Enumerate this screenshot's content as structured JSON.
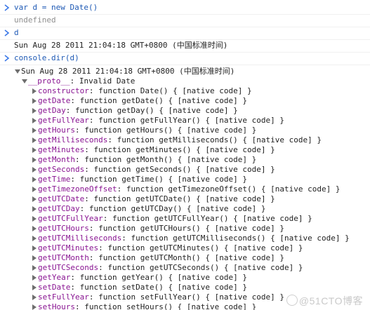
{
  "console": {
    "entries": [
      {
        "kind": "input",
        "text": "var d = new Date()"
      },
      {
        "kind": "result",
        "text": "undefined"
      },
      {
        "kind": "input",
        "text": "d"
      },
      {
        "kind": "result",
        "text": "Sun Aug 28 2011 21:04:18 GMT+0800 (中国标准时间)"
      },
      {
        "kind": "input",
        "text": "console.dir(d)"
      }
    ],
    "dir": {
      "root_label": "Sun Aug 28 2011 21:04:18 GMT+0800 (中国标准时间)",
      "proto_key": "__proto__",
      "proto_value": "Invalid Date",
      "members": [
        {
          "key": "constructor",
          "value": "function Date() { [native code] }"
        },
        {
          "key": "getDate",
          "value": "function getDate() { [native code] }"
        },
        {
          "key": "getDay",
          "value": "function getDay() { [native code] }"
        },
        {
          "key": "getFullYear",
          "value": "function getFullYear() { [native code] }"
        },
        {
          "key": "getHours",
          "value": "function getHours() { [native code] }"
        },
        {
          "key": "getMilliseconds",
          "value": "function getMilliseconds() { [native code] }"
        },
        {
          "key": "getMinutes",
          "value": "function getMinutes() { [native code] }"
        },
        {
          "key": "getMonth",
          "value": "function getMonth() { [native code] }"
        },
        {
          "key": "getSeconds",
          "value": "function getSeconds() { [native code] }"
        },
        {
          "key": "getTime",
          "value": "function getTime() { [native code] }"
        },
        {
          "key": "getTimezoneOffset",
          "value": "function getTimezoneOffset() { [native code] }"
        },
        {
          "key": "getUTCDate",
          "value": "function getUTCDate() { [native code] }"
        },
        {
          "key": "getUTCDay",
          "value": "function getUTCDay() { [native code] }"
        },
        {
          "key": "getUTCFullYear",
          "value": "function getUTCFullYear() { [native code] }"
        },
        {
          "key": "getUTCHours",
          "value": "function getUTCHours() { [native code] }"
        },
        {
          "key": "getUTCMilliseconds",
          "value": "function getUTCMilliseconds() { [native code] }"
        },
        {
          "key": "getUTCMinutes",
          "value": "function getUTCMinutes() { [native code] }"
        },
        {
          "key": "getUTCMonth",
          "value": "function getUTCMonth() { [native code] }"
        },
        {
          "key": "getUTCSeconds",
          "value": "function getUTCSeconds() { [native code] }"
        },
        {
          "key": "getYear",
          "value": "function getYear() { [native code] }"
        },
        {
          "key": "setDate",
          "value": "function setDate() { [native code] }"
        },
        {
          "key": "setFullYear",
          "value": "function setFullYear() { [native code] }"
        },
        {
          "key": "setHours",
          "value": "function setHours() { [native code] }"
        }
      ]
    }
  },
  "watermark": "@51CTO博客",
  "colors": {
    "input_text": "#1f5ab5",
    "undefined_text": "#8f8f8f",
    "property_key": "#881391",
    "prompt_chevron": "#3b78e7",
    "expander": "#6e6e6e"
  },
  "icons": {
    "prompt": "chevron-right-icon",
    "expanded": "triangle-down-icon",
    "collapsed": "triangle-right-icon"
  }
}
